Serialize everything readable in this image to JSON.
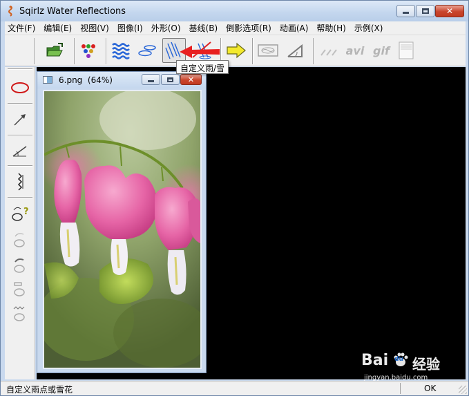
{
  "window": {
    "title": "Sqirlz Water Reflections",
    "controls": {
      "minimize": "minimize",
      "maximize": "maximize",
      "close": "close"
    }
  },
  "menu": [
    "文件(F)",
    "编辑(E)",
    "视图(V)",
    "图像(I)",
    "外形(O)",
    "基线(B)",
    "倒影选项(R)",
    "动画(A)",
    "帮助(H)",
    "示例(X)"
  ],
  "toolbar": {
    "buttons": [
      {
        "name": "open-icon"
      },
      {
        "name": "color-dots-icon"
      },
      {
        "name": "water-waves-icon"
      },
      {
        "name": "ripples-icon"
      },
      {
        "name": "rain-snow-icon",
        "pressed": true
      },
      {
        "name": "rain-snow-disabled-icon"
      },
      {
        "name": "arrow-right-icon"
      },
      {
        "name": "frame-icon"
      },
      {
        "name": "angle-icon"
      },
      {
        "name": "lines-icon"
      },
      {
        "name": "avi-icon",
        "label": "avi"
      },
      {
        "name": "gif-icon",
        "label": "gif"
      },
      {
        "name": "panel-icon"
      }
    ],
    "tooltip": "自定义雨/雪"
  },
  "child_window": {
    "title": "6.png  (64%)"
  },
  "statusbar": {
    "message": "自定义雨点或雪花",
    "state": "OK"
  },
  "watermark": {
    "brand": "Bai",
    "brand2": "du",
    "suffix": "经验",
    "url": "jingyan.baidu.com"
  },
  "colors": {
    "titlebar": "#c3d6ee",
    "workspace": "#000000",
    "accent_red": "#e02020",
    "accent_yellow": "#f3e92c"
  }
}
